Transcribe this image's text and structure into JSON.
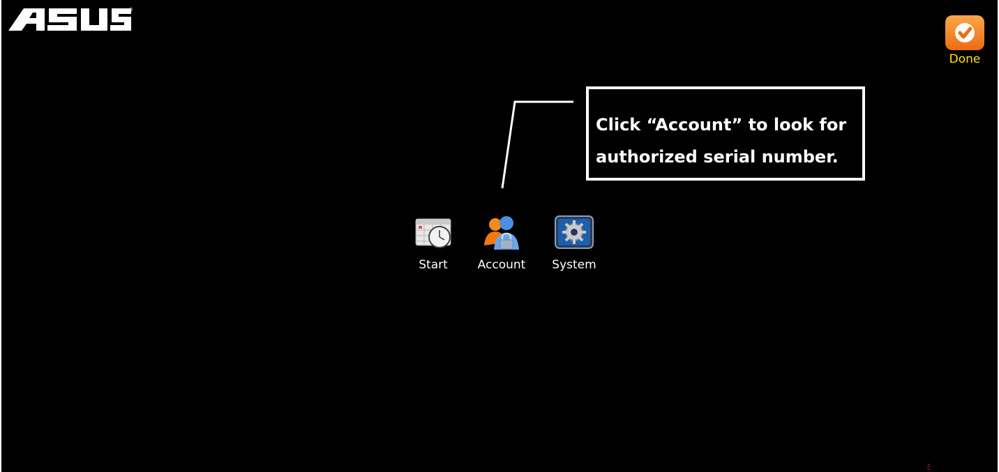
{
  "brand": {
    "logo_text": "ASUS",
    "logo_mark": "®"
  },
  "toolbar": {
    "done_label": "Done",
    "done_icon": "check-icon"
  },
  "callout": {
    "text_line1": "Click “Account” to look for",
    "text_line2": "authorized serial number."
  },
  "apps": [
    {
      "label": "Start",
      "icon": "calendar-clock-icon"
    },
    {
      "label": "Account",
      "icon": "users-lock-icon"
    },
    {
      "label": "System",
      "icon": "gear-monitor-icon"
    }
  ],
  "colors": {
    "background": "#000000",
    "done_label": "#ffe600",
    "done_icon": "#ea6c12",
    "text": "#ffffff"
  }
}
